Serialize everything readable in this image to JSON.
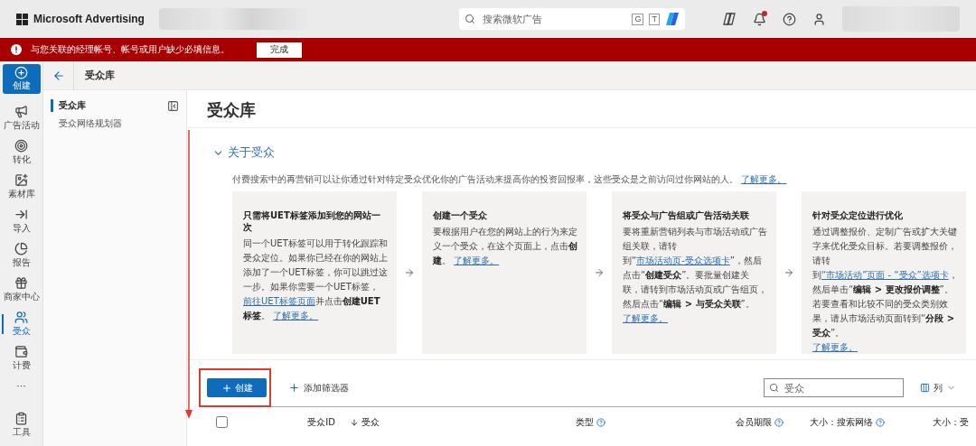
{
  "top_bar": {
    "brand": "Microsoft Advertising",
    "search": {
      "placeholder": "搜索微软广告"
    },
    "search_keys": [
      "G",
      "T"
    ],
    "notifications_unread": true
  },
  "alert": {
    "message": "与您关联的经理帐号、帐号或用户缺少必填信息。",
    "button": "完成"
  },
  "rail": {
    "create": "创建",
    "items": [
      {
        "label": "广告活动",
        "selected": false
      },
      {
        "label": "转化",
        "selected": false
      },
      {
        "label": "素材库",
        "selected": false
      },
      {
        "label": "导入",
        "selected": false
      },
      {
        "label": "报告",
        "selected": false
      },
      {
        "label": "商家中心",
        "selected": false
      },
      {
        "label": "受众",
        "selected": true
      },
      {
        "label": "计费",
        "selected": false
      }
    ],
    "more": "···",
    "bottom": "工具"
  },
  "breadcrumb": "受众库",
  "side_nav": [
    {
      "label": "受众库",
      "selected": true
    },
    {
      "label": "受众网络规划器",
      "selected": false
    }
  ],
  "page_title": "受众库",
  "about": {
    "title": "关于受众",
    "expanded": true,
    "description": "付费搜索中的再营销可以让你通过针对特定受众优化你的广告活动来提高你的投资回报率，这些受众是之前访问过你网站的人。",
    "link": "了解更多。",
    "cards": [
      {
        "title": "只需将UET标签添加到您的网站一次",
        "body": [
          {
            "kind": "text",
            "text": "同一个UET标签可以用于转化跟踪和受众定位。如果你已经在你的网站上添加了一个UET标签，你可以跳过这一步。如果你需要一个UET标签，"
          },
          {
            "kind": "link",
            "text": "前往UET标签页面"
          },
          {
            "kind": "text",
            "text": "并点击**创建UET标签**。 "
          },
          {
            "kind": "link",
            "text": "了解更多。"
          }
        ]
      },
      {
        "title": "创建一个受众",
        "body": [
          {
            "kind": "text",
            "text": "要根据用户在您的网站上的行为来定义一个受众，在这个页面上，点击**创建**。 "
          },
          {
            "kind": "link",
            "text": "了解更多。"
          }
        ]
      },
      {
        "title": "将受众与广告组或广告活动关联",
        "body": [
          {
            "kind": "text",
            "text": "要将重新营销列表与市场活动或广告组关联，请转到“"
          },
          {
            "kind": "link",
            "text": "市场活动页-受众选项卡"
          },
          {
            "kind": "text",
            "text": "”，然后点击“**创建受众**”。要批量创建关联，请转到市场活动页或广告组页，然后点击“**编辑 > 与受众关联**”。"
          },
          {
            "kind": "link-line",
            "text": "了解更多。"
          }
        ]
      },
      {
        "title": "针对受众定位进行优化",
        "body": [
          {
            "kind": "text",
            "text": "通过调整报价、定制广告或扩大关键字来优化受众目标。若要调整报价，请转到"
          },
          {
            "kind": "link",
            "text": "“市场活动”页面 - “受众”选项卡"
          },
          {
            "kind": "text",
            "text": "，然后单击“**编辑 > 更改报价调整**”。若要查看和比较不同的受众类别效果，请从市场活动页面转到“**分段 > 受众**”。"
          },
          {
            "kind": "link-line",
            "text": "了解更多。"
          }
        ]
      }
    ]
  },
  "toolbar": {
    "create": "创建",
    "add_filter": "添加筛选器",
    "search": {
      "placeholder": "受众"
    },
    "columns": "列"
  },
  "table": {
    "select_all": {
      "checked": false
    },
    "columns": [
      {
        "label": "受众ID",
        "sorted": false,
        "help": false
      },
      {
        "label": "受众",
        "sorted": true,
        "help": false
      },
      {
        "label": "类型",
        "sorted": false,
        "help": true
      },
      {
        "label": "会员期限",
        "sorted": false,
        "help": true
      },
      {
        "label": "大小：搜索网络",
        "sorted": false,
        "help": true
      },
      {
        "label": "大小：受",
        "sorted": false,
        "help": false
      }
    ]
  }
}
